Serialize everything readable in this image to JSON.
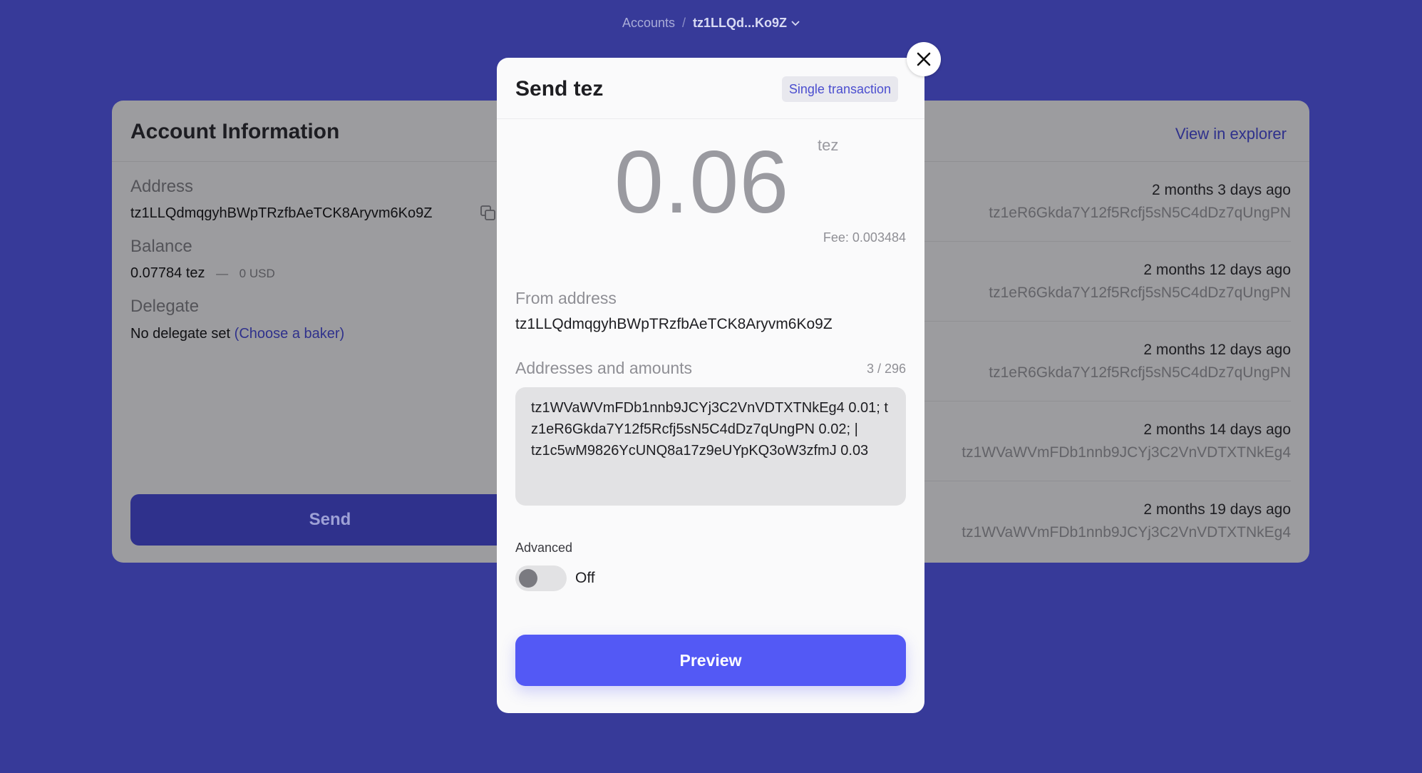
{
  "breadcrumb": {
    "root": "Accounts",
    "separator": "/",
    "current": "tz1LLQd...Ko9Z"
  },
  "account": {
    "title": "Account Information",
    "explorer_link": "View in explorer",
    "address_label": "Address",
    "address": "tz1LLQdmqgyhBWpTRzfbAeTCK8Aryvm6Ko9Z",
    "balance_label": "Balance",
    "balance": "0.07784 tez",
    "balance_sep": "—",
    "balance_fiat": "0 USD",
    "delegate_label": "Delegate",
    "delegate_text": "No delegate set",
    "delegate_link": "(Choose a baker)",
    "send_label": "Send"
  },
  "transactions": [
    {
      "time": "2 months 3 days ago",
      "address": "tz1eR6Gkda7Y12f5Rcfj5sN5C4dDz7qUngPN"
    },
    {
      "time": "2 months 12 days ago",
      "address": "tz1eR6Gkda7Y12f5Rcfj5sN5C4dDz7qUngPN"
    },
    {
      "time": "2 months 12 days ago",
      "address": "tz1eR6Gkda7Y12f5Rcfj5sN5C4dDz7qUngPN"
    },
    {
      "time": "2 months 14 days ago",
      "address": "tz1WVaWVmFDb1nnb9JCYj3C2VnVDTXTNkEg4"
    },
    {
      "time": "2 months 19 days ago",
      "address": "tz1WVaWVmFDb1nnb9JCYj3C2VnVDTXTNkEg4"
    }
  ],
  "modal": {
    "title": "Send tez",
    "tx_type": "Single transaction",
    "amount": "0.06",
    "amount_unit": "tez",
    "fee": "Fee: 0.003484",
    "from_label": "From address",
    "from_address": "tz1LLQdmqgyhBWpTRzfbAeTCK8Aryvm6Ko9Z",
    "recipients_label": "Addresses and amounts",
    "recipients_counter": "3 / 296",
    "recipients_value": "tz1WVaWVmFDb1nnb9JCYj3C2VnVDTXTNkEg4 0.01; tz1eR6Gkda7Y12f5Rcfj5sN5C4dDz7qUngPN 0.02; |\ntz1c5wM9826YcUNQ8a17z9eUYpKQ3oW3zfmJ 0.03",
    "advanced_label": "Advanced",
    "advanced_state": "Off",
    "preview_label": "Preview"
  },
  "colors": {
    "page_bg": "#373a99",
    "accent": "#5359f5",
    "link": "#4b4ecf"
  },
  "icons": {
    "close": "close-icon",
    "copy": "copy-icon",
    "chevron": "chevron-down-icon"
  }
}
